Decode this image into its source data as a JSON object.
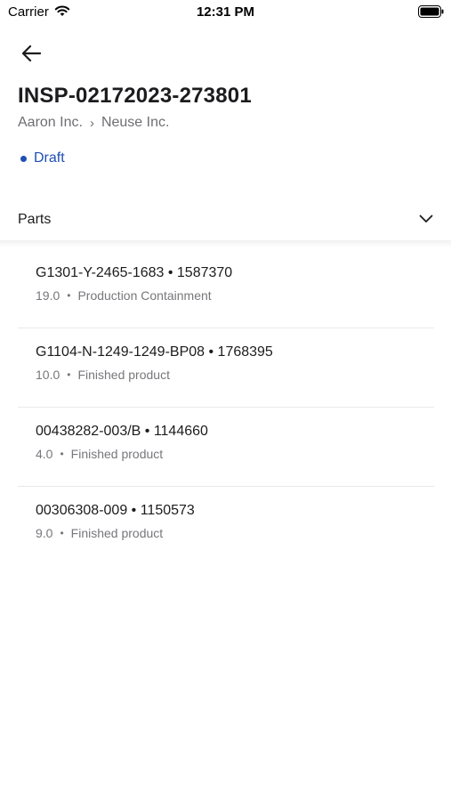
{
  "status_bar": {
    "carrier": "Carrier",
    "time": "12:31 PM"
  },
  "header": {
    "title": "INSP-02172023-273801",
    "breadcrumb": [
      "Aaron Inc.",
      "Neuse Inc."
    ],
    "breadcrumb_separator": "›",
    "status": "Draft",
    "status_color": "#1f4fb4"
  },
  "section": {
    "title": "Parts"
  },
  "parts": [
    {
      "title": "G1301-Y-2465-1683 • 1587370",
      "quantity": "19.0",
      "type": "Production Containment"
    },
    {
      "title": "G1104-N-1249-1249-BP08 • 1768395",
      "quantity": "10.0",
      "type": "Finished product"
    },
    {
      "title": "00438282-003/B • 1144660",
      "quantity": "4.0",
      "type": "Finished product"
    },
    {
      "title": "00306308-009 • 1150573",
      "quantity": "9.0",
      "type": "Finished product"
    }
  ]
}
